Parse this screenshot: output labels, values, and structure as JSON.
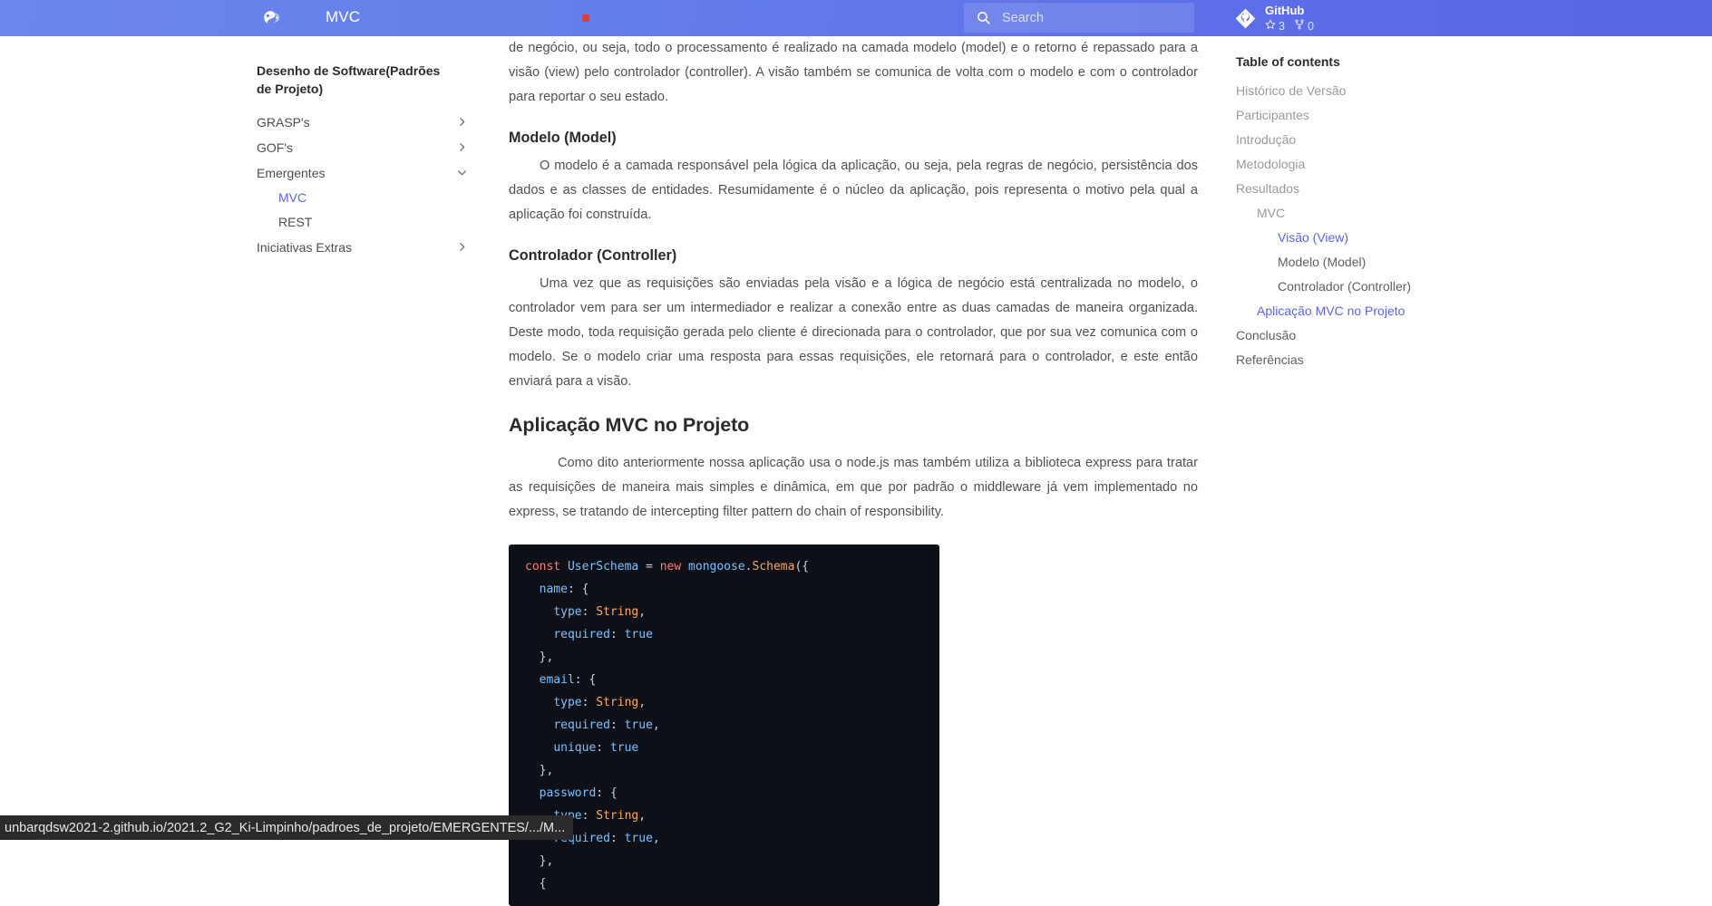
{
  "header": {
    "logo_icon": "yin-yang-logo-icon",
    "title": "MVC",
    "notification_dot": "red-dot-indicator",
    "search": {
      "icon": "search-icon",
      "placeholder": "Search",
      "value": ""
    },
    "repo": {
      "icon": "github-icon",
      "name": "GitHub",
      "stars_icon": "star-icon",
      "stars": "3",
      "forks_icon": "fork-icon",
      "forks": "0"
    }
  },
  "sidebar": {
    "title": "Desenho de Software(Padrões de Projeto)",
    "items": [
      {
        "label": "GRASP's",
        "icon": "chevron-right-icon",
        "level": 1,
        "expanded": false,
        "active": false
      },
      {
        "label": "GOF's",
        "icon": "chevron-right-icon",
        "level": 1,
        "expanded": false,
        "active": false
      },
      {
        "label": "Emergentes",
        "icon": "chevron-down-icon",
        "level": 1,
        "expanded": true,
        "active": false
      },
      {
        "label": "MVC",
        "icon": "",
        "level": 2,
        "expanded": false,
        "active": true
      },
      {
        "label": "REST",
        "icon": "",
        "level": 2,
        "expanded": false,
        "active": false
      },
      {
        "label": "Iniciativas Extras",
        "icon": "chevron-right-icon",
        "level": 1,
        "expanded": false,
        "active": false
      }
    ]
  },
  "main": {
    "intro_paragraph": "de negócio, ou seja, todo o processamento é realizado na camada modelo (model) e o retorno é repassado para a visão (view) pelo controlador (controller). A visão também se comunica de volta com o modelo e com o controlador para reportar o seu estado.",
    "modelo_heading": "Modelo (Model)",
    "modelo_paragraph": "O modelo é a camada responsável pela lógica da aplicação, ou seja, pela regras de negócio, persistência dos dados e as classes de entidades. Resumidamente é o núcleo da aplicação, pois representa o motivo pela qual a aplicação foi construída.",
    "controlador_heading": "Controlador (Controller)",
    "controlador_paragraph": "Uma vez que as requisições são enviadas pela visão e a lógica de negócio está centralizada no modelo, o controlador vem para ser um intermediador e realizar a conexão entre as duas camadas de maneira organizada. Deste modo, toda requisição gerada pelo cliente é direcionada para o controlador, que por sua vez comunica com o modelo. Se o modelo criar uma resposta para essas requisições, ele retornará para o controlador, e este então enviará para a visão.",
    "aplicacao_heading": "Aplicação MVC no Projeto",
    "aplicacao_paragraph": "Como dito anteriormente nossa aplicação usa o node.js mas também utiliza a biblioteca express para tratar as requisições de maneira mais simples e dinâmica, em que por padrão o middleware já vem implementado no express, se tratando de intercepting filter pattern do chain of responsibility.",
    "code": {
      "language": "javascript",
      "lines": [
        "const UserSchema = new mongoose.Schema({",
        "  name: {",
        "    type: String,",
        "    required: true",
        "  },",
        "  email: {",
        "    type: String,",
        "    required: true,",
        "    unique: true",
        "  },",
        "  password: {",
        "    type: String,",
        "    required: true,",
        "  },",
        "  {"
      ]
    }
  },
  "toc": {
    "title": "Table of contents",
    "items": [
      {
        "label": "Histórico de Versão",
        "level": 1,
        "active": false,
        "accent": false
      },
      {
        "label": "Participantes",
        "level": 1,
        "active": false,
        "accent": false
      },
      {
        "label": "Introdução",
        "level": 1,
        "active": false,
        "accent": false
      },
      {
        "label": "Metodologia",
        "level": 1,
        "active": false,
        "accent": false
      },
      {
        "label": "Resultados",
        "level": 1,
        "active": false,
        "accent": false
      },
      {
        "label": "MVC",
        "level": 2,
        "active": false,
        "accent": false
      },
      {
        "label": "Visão (View)",
        "level": 3,
        "active": true,
        "accent": false
      },
      {
        "label": "Modelo (Model)",
        "level": 3,
        "active": false,
        "accent": false
      },
      {
        "label": "Controlador (Controller)",
        "level": 3,
        "active": false,
        "accent": false
      },
      {
        "label": "Aplicação MVC no Projeto",
        "level": 2,
        "active": false,
        "accent": true
      },
      {
        "label": "Conclusão",
        "level": 1,
        "active": false,
        "accent": false
      },
      {
        "label": "Referências",
        "level": 1,
        "active": false,
        "accent": false
      }
    ]
  },
  "statusbar": {
    "url": "unbarqdsw2021-2.github.io/2021.2_G2_Ki-Limpinho/padroes_de_projeto/EMERGENTES/.../M..."
  },
  "colors": {
    "header_bg": "#6070ea",
    "accent": "#5865f2",
    "code_bg": "#0d1117",
    "notification": "#e03a3a",
    "status_bg": "#2b2b2b"
  }
}
